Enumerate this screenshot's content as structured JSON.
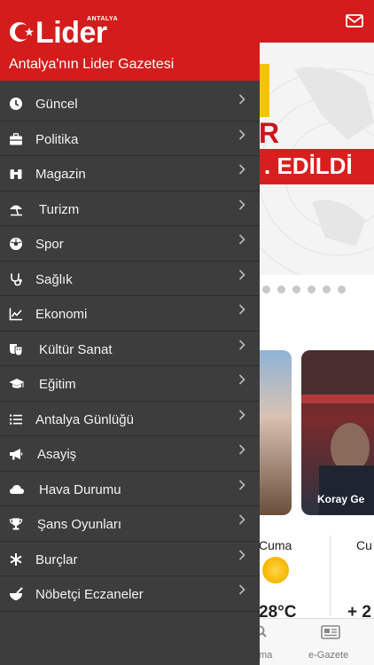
{
  "drawer": {
    "logo_antalya": "ANTALYA",
    "logo_text": "Lider",
    "tagline": "Antalya'nın Lider Gazetesi",
    "items": [
      {
        "label": "Güncel",
        "icon": "clock-icon"
      },
      {
        "label": "Politika",
        "icon": "briefcase-icon"
      },
      {
        "label": "Magazin",
        "icon": "binoculars-icon"
      },
      {
        "label": "Turizm",
        "icon": "beach-umbrella-icon"
      },
      {
        "label": "Spor",
        "icon": "soccer-ball-icon"
      },
      {
        "label": "Sağlık",
        "icon": "stethoscope-icon"
      },
      {
        "label": "Ekonomi",
        "icon": "line-chart-icon"
      },
      {
        "label": "Kültür Sanat",
        "icon": "theater-masks-icon"
      },
      {
        "label": "Eğitim",
        "icon": "graduation-cap-icon"
      },
      {
        "label": "Antalya Günlüğü",
        "icon": "list-icon"
      },
      {
        "label": "Asayiş",
        "icon": "megaphone-icon"
      },
      {
        "label": "Hava Durumu",
        "icon": "cloud-icon"
      },
      {
        "label": "Şans Oyunları",
        "icon": "trophy-icon"
      },
      {
        "label": "Burçlar",
        "icon": "asterisk-icon"
      },
      {
        "label": "Nöbetçi Eczaneler",
        "icon": "mortar-pestle-icon"
      }
    ]
  },
  "background": {
    "banner_letter": "R",
    "banner_text": ". EDİLDİ",
    "card_label": "Koray Ge",
    "weather": [
      {
        "day": "Cuma",
        "temp": "28°C"
      },
      {
        "day": "Cu",
        "temp": "+ 2"
      }
    ],
    "bottom_nav": {
      "search_label": "ma",
      "egazete_label": "e-Gazete"
    }
  },
  "colors": {
    "brand_red": "#d41c1c",
    "drawer_bg": "#3d3d3d"
  }
}
